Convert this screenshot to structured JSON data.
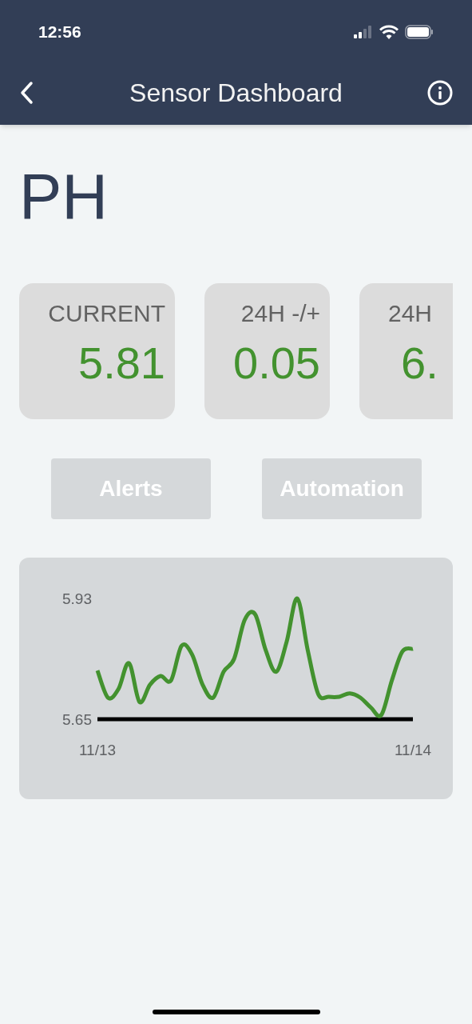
{
  "status_bar": {
    "time": "12:56"
  },
  "nav": {
    "title": "Sensor Dashboard"
  },
  "sensor": {
    "name": "PH"
  },
  "stats": [
    {
      "label": "CURRENT",
      "value": "5.81",
      "kind": "full"
    },
    {
      "label": "24H -/+",
      "value": "0.05",
      "kind": "full"
    },
    {
      "label": "24H",
      "value": "6.",
      "kind": "partial"
    }
  ],
  "buttons": [
    {
      "label": "Alerts"
    },
    {
      "label": "Automation"
    }
  ],
  "chart_data": {
    "type": "line",
    "categories": [
      "11/13",
      null,
      null,
      null,
      null,
      null,
      null,
      null,
      null,
      null,
      null,
      null,
      null,
      null,
      null,
      null,
      null,
      null,
      null,
      null,
      null,
      null,
      null,
      null,
      null,
      null,
      null,
      null,
      null,
      null,
      "11/14"
    ],
    "series": [
      {
        "color": "#43922f",
        "values": [
          5.763,
          5.7,
          5.72,
          5.78,
          5.69,
          5.73,
          5.75,
          5.74,
          5.82,
          5.8,
          5.73,
          5.7,
          5.76,
          5.79,
          5.88,
          5.893,
          5.81,
          5.76,
          5.83,
          5.93,
          5.81,
          5.708,
          5.702,
          5.702,
          5.71,
          5.7,
          5.677,
          5.66,
          5.74,
          5.807,
          5.813
        ]
      }
    ],
    "ylim": [
      5.65,
      5.93
    ],
    "yticks": [
      5.65,
      5.93
    ]
  }
}
